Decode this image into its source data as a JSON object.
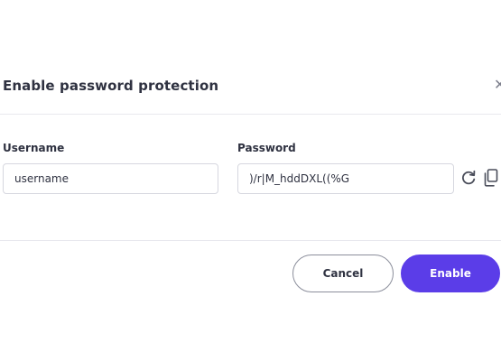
{
  "dialog": {
    "title": "Enable password protection",
    "close_icon": "close-icon"
  },
  "form": {
    "username": {
      "label": "Username",
      "value": "username"
    },
    "password": {
      "label": "Password",
      "value": ")/r|M_hddDXL((%G",
      "actions": [
        "refresh-icon",
        "copy-icon"
      ]
    }
  },
  "buttons": {
    "cancel_label": "Cancel",
    "enable_label": "Enable"
  },
  "colors": {
    "accent": "#5b3de8",
    "text": "#2f3241",
    "border": "#d6d7df",
    "divider": "#e8e8ee"
  }
}
